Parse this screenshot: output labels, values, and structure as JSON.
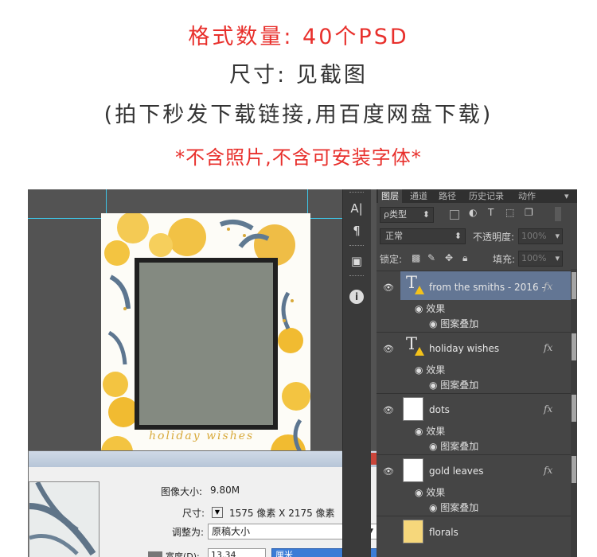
{
  "header": {
    "line1": "格式数量: 40个PSD",
    "line2": "尺寸: 见截图",
    "line3": "(拍下秒发下载链接,用百度网盘下载)",
    "line4": "*不含照片,不含可安装字体*"
  },
  "canvas": {
    "doc_script_text": "holiday wishes"
  },
  "tools": {
    "char_icon": "A|",
    "para_icon": "¶",
    "info_icon": "i"
  },
  "panel": {
    "tabs": [
      "图层",
      "通道",
      "路径",
      "历史记录",
      "动作"
    ],
    "filter_label": "ρ类型",
    "blend_mode": "正常",
    "opacity_label": "不透明度:",
    "opacity_value": "100%",
    "lock_label": "锁定:",
    "fill_label": "填充:",
    "fill_value": "100%",
    "layers": [
      {
        "name": "from the smiths - 2016 -",
        "kind": "text",
        "selected": true,
        "effects_label": "效果",
        "effect": "图案叠加"
      },
      {
        "name": "holiday wishes",
        "kind": "text",
        "selected": false,
        "effects_label": "效果",
        "effect": "图案叠加"
      },
      {
        "name": "dots",
        "kind": "pixel",
        "selected": false,
        "effects_label": "效果",
        "effect": "图案叠加"
      },
      {
        "name": "gold leaves",
        "kind": "pixel",
        "selected": false,
        "effects_label": "效果",
        "effect": "图案叠加"
      },
      {
        "name": "florals",
        "kind": "pixel",
        "selected": false
      }
    ],
    "fx_label": "fx"
  },
  "dialog": {
    "close_label": "x",
    "image_size_label": "图像大小:",
    "image_size_value": "9.80M",
    "dims_label": "尺寸:",
    "dims_value": "1575 像素  X  2175 像素",
    "resample_label": "调整为:",
    "resample_value": "原稿大小",
    "width_label": "宽度(D):",
    "width_value": "13.34",
    "unit_value": "厘米"
  }
}
